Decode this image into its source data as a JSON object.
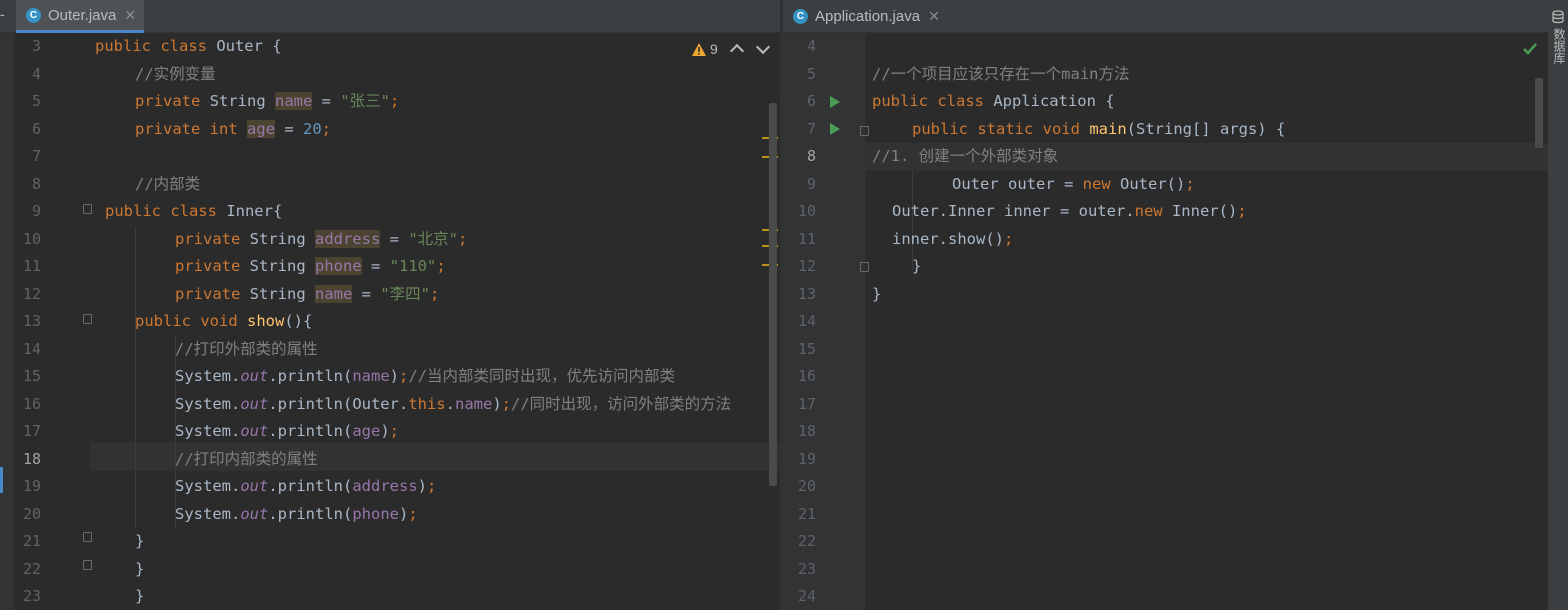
{
  "left_tab": {
    "label": "Outer.java",
    "icon": "C",
    "close": "✕"
  },
  "right_tab": {
    "label": "Application.java",
    "icon": "C",
    "close": "✕"
  },
  "inspection": {
    "warning_count": "9",
    "up": "⌃",
    "down": "⌄"
  },
  "sidebar_right": {
    "label": "数据库"
  },
  "left_lines": [
    {
      "n": "3"
    },
    {
      "n": "4"
    },
    {
      "n": "5"
    },
    {
      "n": "6"
    },
    {
      "n": "7"
    },
    {
      "n": "8"
    },
    {
      "n": "9"
    },
    {
      "n": "10"
    },
    {
      "n": "11"
    },
    {
      "n": "12"
    },
    {
      "n": "13"
    },
    {
      "n": "14"
    },
    {
      "n": "15"
    },
    {
      "n": "16"
    },
    {
      "n": "17"
    },
    {
      "n": "18"
    },
    {
      "n": "19"
    },
    {
      "n": "20"
    },
    {
      "n": "21"
    },
    {
      "n": "22"
    },
    {
      "n": "23"
    }
  ],
  "left_code": {
    "l3_a": "public class",
    "l3_b": " Outer {",
    "l4": "//实例变量",
    "l5_kw": "private",
    "l5_t": " String ",
    "l5_f": "name",
    "l5_eq": " = ",
    "l5_s": "\"张三\"",
    "l5_end": ";",
    "l6_kw": "private int",
    "l6_sp": " ",
    "l6_f": "age",
    "l6_eq": " = ",
    "l6_n": "20",
    "l6_end": ";",
    "l8": "//内部类",
    "l9_kw": "public class",
    "l9_b": " Inner{",
    "l10_kw": "private",
    "l10_t": " String ",
    "l10_f": "address",
    "l10_eq": " = ",
    "l10_s": "\"北京\"",
    "l10_end": ";",
    "l11_kw": "private",
    "l11_t": " String ",
    "l11_f": "phone",
    "l11_eq": " = ",
    "l11_s": "\"110\"",
    "l11_end": ";",
    "l12_kw": "private",
    "l12_t": " String ",
    "l12_f": "name",
    "l12_eq": " = ",
    "l12_s": "\"李四\"",
    "l12_end": ";",
    "l13_kw": "public void",
    "l13_sp": " ",
    "l13_m": "show",
    "l13_b": "(){",
    "l14": "//打印外部类的属性",
    "l15_a": "System.",
    "l15_o": "out",
    "l15_b": ".println(",
    "l15_f": "name",
    "l15_c": ")",
    "l15_semi": ";",
    "l15_cm": "//当内部类同时出现，优先访问内部类",
    "l16_a": "System.",
    "l16_o": "out",
    "l16_b": ".println(Outer.",
    "l16_this": "this",
    "l16_dot": ".",
    "l16_f": "name",
    "l16_c": ")",
    "l16_semi": ";",
    "l16_cm": "//同时出现，访问外部类的方法",
    "l17_a": "System.",
    "l17_o": "out",
    "l17_b": ".println(",
    "l17_f": "age",
    "l17_c": ")",
    "l17_semi": ";",
    "l18": "//打印内部类的属性",
    "l19_a": "System.",
    "l19_o": "out",
    "l19_b": ".println(",
    "l19_f": "address",
    "l19_c": ")",
    "l19_semi": ";",
    "l20_a": "System.",
    "l20_o": "out",
    "l20_b": ".println(",
    "l20_f": "phone",
    "l20_c": ")",
    "l20_semi": ";",
    "l21": "}",
    "l22": "}",
    "l23": "}"
  },
  "right_lines": [
    {
      "n": "4"
    },
    {
      "n": "5"
    },
    {
      "n": "6"
    },
    {
      "n": "7"
    },
    {
      "n": "8"
    },
    {
      "n": "9"
    },
    {
      "n": "10"
    },
    {
      "n": "11"
    },
    {
      "n": "12"
    },
    {
      "n": "13"
    },
    {
      "n": "14"
    },
    {
      "n": "15"
    },
    {
      "n": "16"
    },
    {
      "n": "17"
    },
    {
      "n": "18"
    },
    {
      "n": "19"
    },
    {
      "n": "20"
    },
    {
      "n": "21"
    },
    {
      "n": "22"
    },
    {
      "n": "23"
    },
    {
      "n": "24"
    }
  ],
  "right_code": {
    "r5": "//一个项目应该只存在一个main方法",
    "r6_kw": "public class",
    "r6_b": " Application {",
    "r7_kw": "public static void",
    "r7_sp": " ",
    "r7_m": "main",
    "r7_b": "(String[] args) {",
    "r8": "//1. 创建一个外部类对象",
    "r9_a": "Outer outer = ",
    "r9_kw": "new",
    "r9_b": " Outer()",
    "r9_semi": ";",
    "r10_a": "Outer.Inner inner = outer.",
    "r10_kw": "new",
    "r10_b": " Inner()",
    "r10_semi": ";",
    "r11_a": "inner.show()",
    "r11_semi": ";",
    "r12": "}",
    "r13": "}"
  },
  "colors": {
    "keyword": "#cc7832",
    "string": "#6a8759",
    "number": "#6897bb",
    "comment": "#808080",
    "field": "#9876aa",
    "method": "#ffc66d",
    "text": "#a9b7c6",
    "run": "#499c54",
    "warning": "#be9117"
  }
}
